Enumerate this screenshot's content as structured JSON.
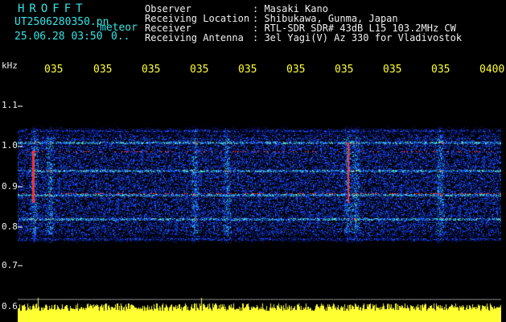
{
  "file": {
    "logo": "HROFFT",
    "filename": "UT2506280350.pn",
    "mode": "meteor",
    "datetime": "25.06.28 03:50",
    "count": "0.."
  },
  "observer": {
    "labels": [
      "Observer",
      "Receiving Location",
      "Receiver",
      "Receiving Antenna"
    ],
    "values": [
      ": Masaki Kano",
      ": Shibukawa, Gunma, Japan",
      ": RTL-SDR SDR# 43dB L15 103.2MHz CW",
      ": 3el Yagi(V) Az 330 for Vladivostok"
    ]
  },
  "axis": {
    "y_unit": "kHz",
    "y_ticks": [
      "1.1",
      "1.0",
      "0.9",
      "0.8",
      "0.7",
      "0.6"
    ],
    "x_ticks": [
      "035",
      "035",
      "035",
      "035",
      "035",
      "035",
      "035",
      "035",
      "035",
      "0400"
    ]
  },
  "colors": {
    "background": "#000000",
    "spectrum_low": "#0a1a8c",
    "spectrum_mid": "#2a5cff",
    "spectrum_hot": "#33e6e6",
    "peak": "#ff3333",
    "amplitude": "#ffff33",
    "header_accent": "#33e6e6"
  }
}
